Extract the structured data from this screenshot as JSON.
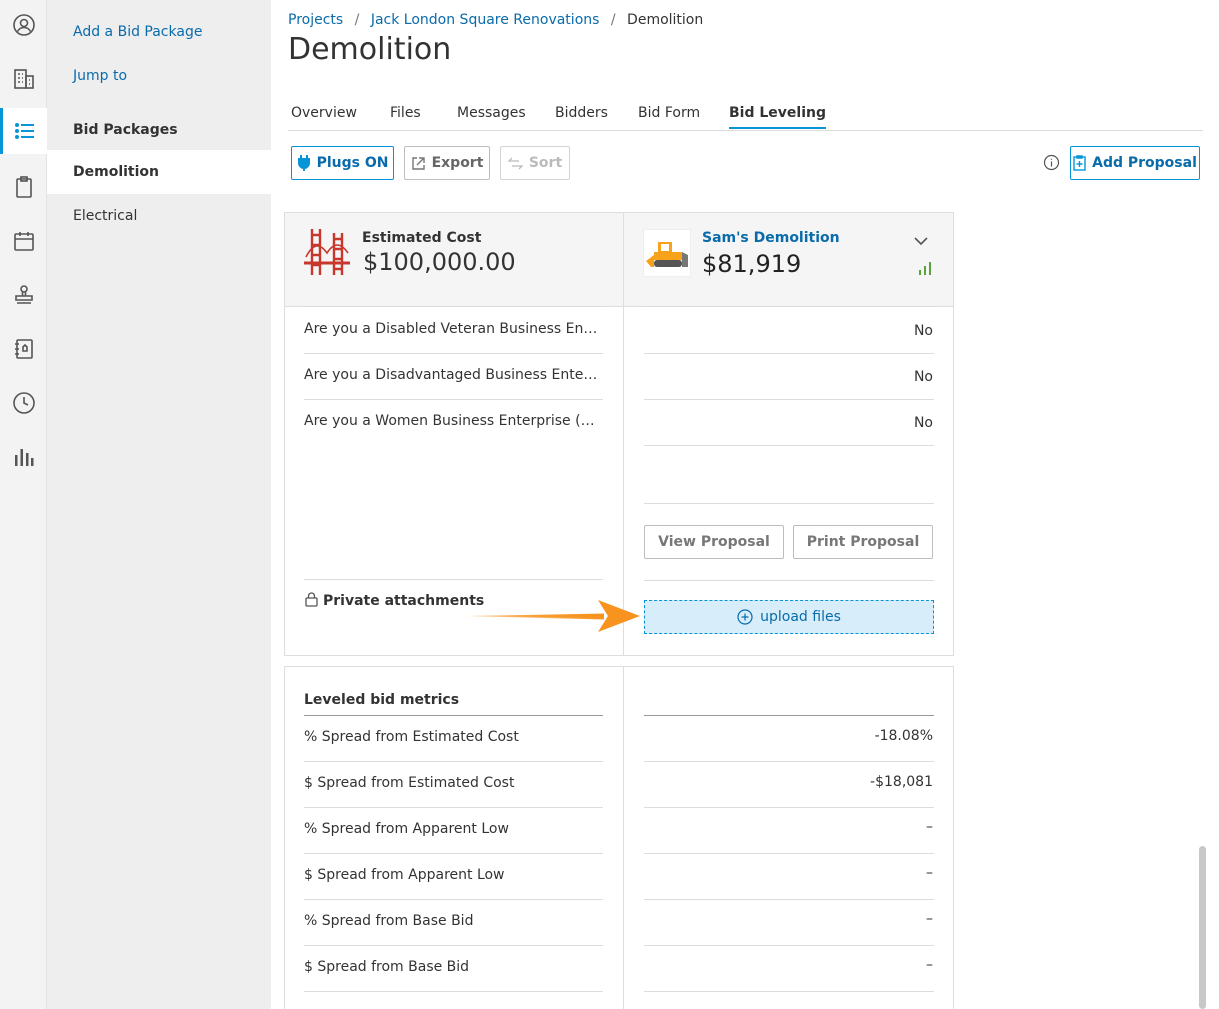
{
  "rail": {
    "icons": [
      "user-circle-icon",
      "building-icon",
      "list-icon",
      "clipboard-icon",
      "calendar-icon",
      "stamp-icon",
      "notebook-icon",
      "clock-icon",
      "bar-chart-icon"
    ]
  },
  "subnav": {
    "add_bid_package": "Add a Bid Package",
    "jump_to": "Jump to",
    "bid_packages": "Bid Packages",
    "demolition": "Demolition",
    "electrical": "Electrical"
  },
  "breadcrumb": {
    "projects": "Projects",
    "sep1": "/",
    "project": "Jack London Square Renovations",
    "sep2": "/",
    "current": "Demolition"
  },
  "page_title": "Demolition",
  "tabs": [
    "Overview",
    "Files",
    "Messages",
    "Bidders",
    "Bid Form",
    "Bid Leveling"
  ],
  "toolbar": {
    "plugs": "Plugs ON",
    "export": "Export",
    "sort": "Sort",
    "add_proposal": "Add Proposal"
  },
  "estimate": {
    "label": "Estimated Cost",
    "amount": "$100,000.00"
  },
  "bidder": {
    "name": "Sam's Demolition",
    "amount": "$81,919"
  },
  "questions": [
    {
      "label": "Are you a Disabled Veteran Business Enterprise (DVBE)?",
      "value": "No"
    },
    {
      "label": "Are you a Disadvantaged Business Enterprise (DBE)?",
      "value": "No"
    },
    {
      "label": "Are you a Women Business Enterprise (WBE)?",
      "value": "No"
    }
  ],
  "proposal_buttons": {
    "view": "View Proposal",
    "print": "Print Proposal"
  },
  "attachments": {
    "label": "Private attachments",
    "upload": "upload files"
  },
  "metrics": {
    "heading": "Leveled bid metrics",
    "rows": [
      {
        "label": "% Spread from Estimated Cost",
        "value": "-18.08%"
      },
      {
        "label": "$ Spread from Estimated Cost",
        "value": "-$18,081"
      },
      {
        "label": "% Spread from Apparent Low",
        "value": "–"
      },
      {
        "label": "$ Spread from Apparent Low",
        "value": "–"
      },
      {
        "label": "% Spread from Base Bid",
        "value": "–"
      },
      {
        "label": "$ Spread from Base Bid",
        "value": "–"
      }
    ]
  },
  "colors": {
    "accent": "#0696d7",
    "link": "#0a6bab",
    "arrow": "#f7931e",
    "upload_bg": "#d7eefa"
  }
}
